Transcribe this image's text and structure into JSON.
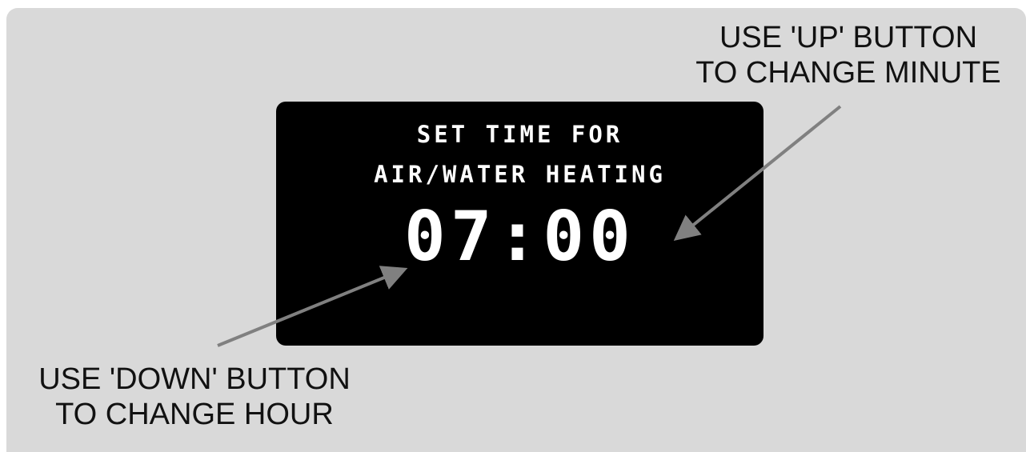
{
  "display": {
    "line1": "SET TIME FOR",
    "line2": "AIR/WATER HEATING",
    "time": "07:00"
  },
  "callouts": {
    "up": {
      "line1": "USE 'UP' BUTTON",
      "line2": "TO CHANGE MINUTE"
    },
    "down": {
      "line1": "USE 'DOWN' BUTTON",
      "line2": "TO CHANGE HOUR"
    }
  },
  "colors": {
    "panel": "#d9d9d9",
    "screen": "#000000",
    "screen_text": "#ffffff",
    "arrow": "#808080",
    "label_text": "#111111"
  }
}
